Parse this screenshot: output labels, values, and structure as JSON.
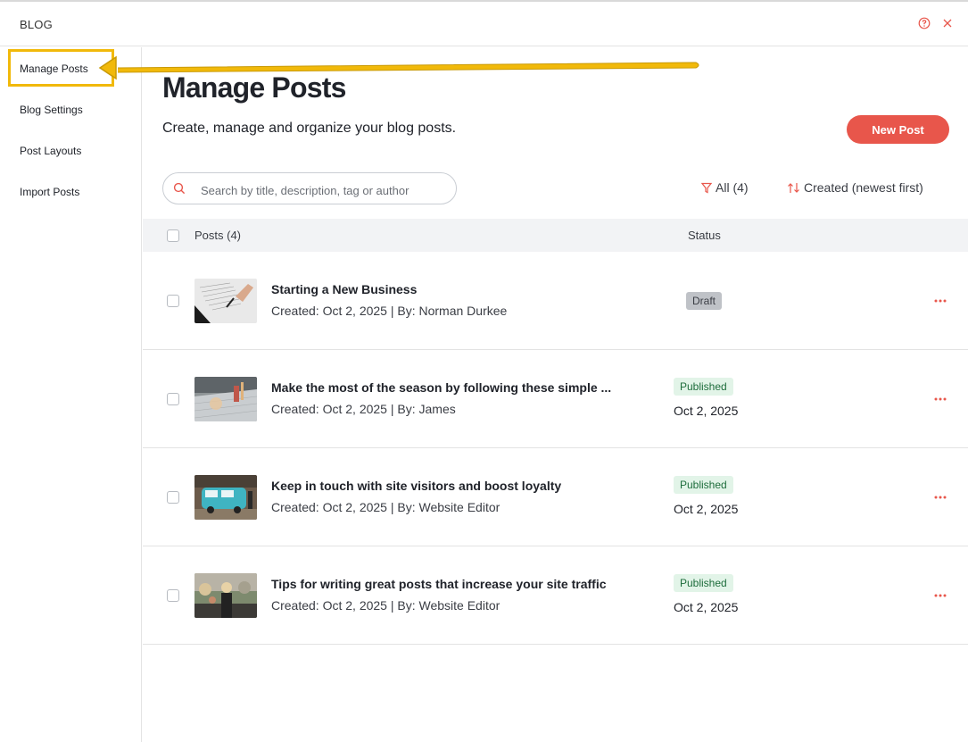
{
  "header": {
    "title": "BLOG",
    "help_icon": "help-icon",
    "close_icon": "close-icon",
    "accent": "#e8564b"
  },
  "sidebar": {
    "items": [
      {
        "label": "Manage Posts"
      },
      {
        "label": "Blog Settings"
      },
      {
        "label": "Post Layouts"
      },
      {
        "label": "Import Posts"
      }
    ],
    "highlight_color": "#f1b90a"
  },
  "main": {
    "title": "Manage Posts",
    "subtitle": "Create, manage and organize your blog posts.",
    "new_post_label": "New Post",
    "search_placeholder": "Search by title, description, tag or author",
    "filter_label": "All (4)",
    "sort_label": "Created (newest first)",
    "table": {
      "col_posts": "Posts (4)",
      "col_status": "Status",
      "rows": [
        {
          "title": "Starting a New Business",
          "meta": "Created: Oct 2, 2025 | By: Norman Durkee",
          "status": "Draft",
          "status_date": ""
        },
        {
          "title": "Make the most of the season by following these simple ...",
          "meta": "Created: Oct 2, 2025 | By: James",
          "status": "Published",
          "status_date": "Oct 2, 2025"
        },
        {
          "title": "Keep in touch with site visitors and boost loyalty",
          "meta": "Created: Oct 2, 2025 | By: Website Editor",
          "status": "Published",
          "status_date": "Oct 2, 2025"
        },
        {
          "title": "Tips for writing great posts that increase your site traffic",
          "meta": "Created: Oct 2, 2025 | By: Website Editor",
          "status": "Published",
          "status_date": "Oct 2, 2025"
        }
      ]
    }
  }
}
